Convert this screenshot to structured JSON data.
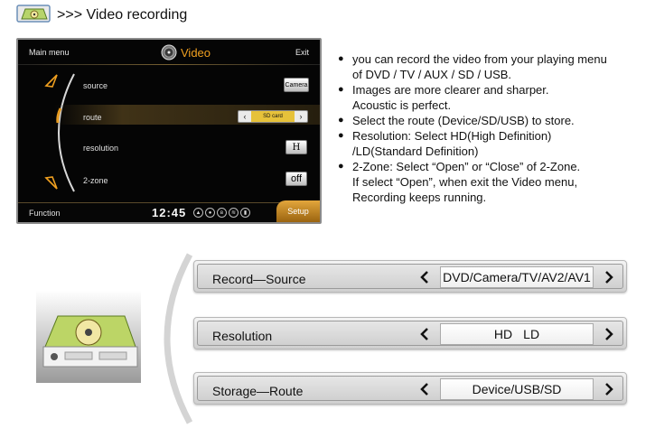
{
  "header": {
    "title": ">>> Video recording"
  },
  "screen": {
    "top": {
      "main_menu": "Main menu",
      "title": "Video",
      "exit": "Exit"
    },
    "rows": [
      {
        "label": "source",
        "value": "Camera"
      },
      {
        "label": "route",
        "value": "SD card"
      },
      {
        "label": "resolution",
        "value": "H"
      },
      {
        "label": "2-zone",
        "value": "off"
      }
    ],
    "bottom": {
      "function": "Function",
      "time": "12:45",
      "setup": "Setup"
    }
  },
  "bullets": [
    {
      "text": "you can record the video from your playing menu"
    },
    {
      "text": "of DVD / TV / AUX / SD / USB.",
      "cont": true
    },
    {
      "text": "Images are more clearer and sharper."
    },
    {
      "text": "Acoustic is perfect.",
      "cont": true
    },
    {
      "text": "Select the route (Device/SD/USB) to store."
    },
    {
      "text": "Resolution: Select HD(High Definition)"
    },
    {
      "text": "/LD(Standard Definition)",
      "cont": true
    },
    {
      "text": "2-Zone: Select “Open” or “Close” of 2-Zone."
    },
    {
      "text": "If select “Open”, when exit the Video menu,",
      "cont": true
    },
    {
      "text": "Recording keeps running.",
      "cont": true
    }
  ],
  "options": [
    {
      "label": "Record—Source",
      "value": "DVD/Camera/TV/AV2/AV1"
    },
    {
      "label": "Resolution",
      "value_a": "HD",
      "value_b": "LD"
    },
    {
      "label": "Storage—Route",
      "value": "Device/USB/SD"
    }
  ],
  "icons": {
    "header": "dvd-recorder-icon",
    "screen_title": "video-disc-icon",
    "arrows": [
      "arrow-up-icon",
      "arrow-down-icon"
    ],
    "status": [
      "navigation-icon",
      "record-icon",
      "bluetooth-icon",
      "wifi-icon",
      "signal-icon"
    ]
  },
  "colors": {
    "accent": "#f0a020",
    "screen_bg": "#050505",
    "setup_tab": "#d08a22",
    "route_value": "#e6c23a"
  }
}
